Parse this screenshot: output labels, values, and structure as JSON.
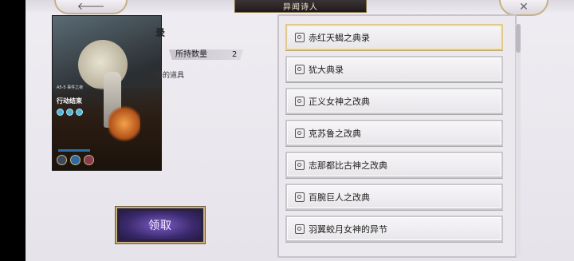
{
  "header": {
    "title": "异闻诗人",
    "back_glyph": "🡐",
    "close_glyph": "✕"
  },
  "item": {
    "title": "录",
    "count_label": "所持数量",
    "count_value": "2",
    "description": "器的道具"
  },
  "card": {
    "label_small": "A5-5\n事件之夜",
    "name": "行动结束"
  },
  "claim_button": {
    "label": "领取"
  },
  "list": {
    "selected_index": 0,
    "items": [
      {
        "label": "赤红天蝎之典录"
      },
      {
        "label": "犹大典录"
      },
      {
        "label": "正义女神之改典"
      },
      {
        "label": "克苏鲁之改典"
      },
      {
        "label": "志那都比古神之改典"
      },
      {
        "label": "百腕巨人之改典"
      },
      {
        "label": "羽翼蛟月女神的异节"
      }
    ]
  },
  "icons": {
    "back": "arrow-left-icon",
    "close": "close-icon",
    "list_item": "book-icon"
  },
  "colors": {
    "accent_gold": "#c9b07a",
    "claim_button": "#3b2a6e",
    "title_tab": "#2a2325"
  }
}
